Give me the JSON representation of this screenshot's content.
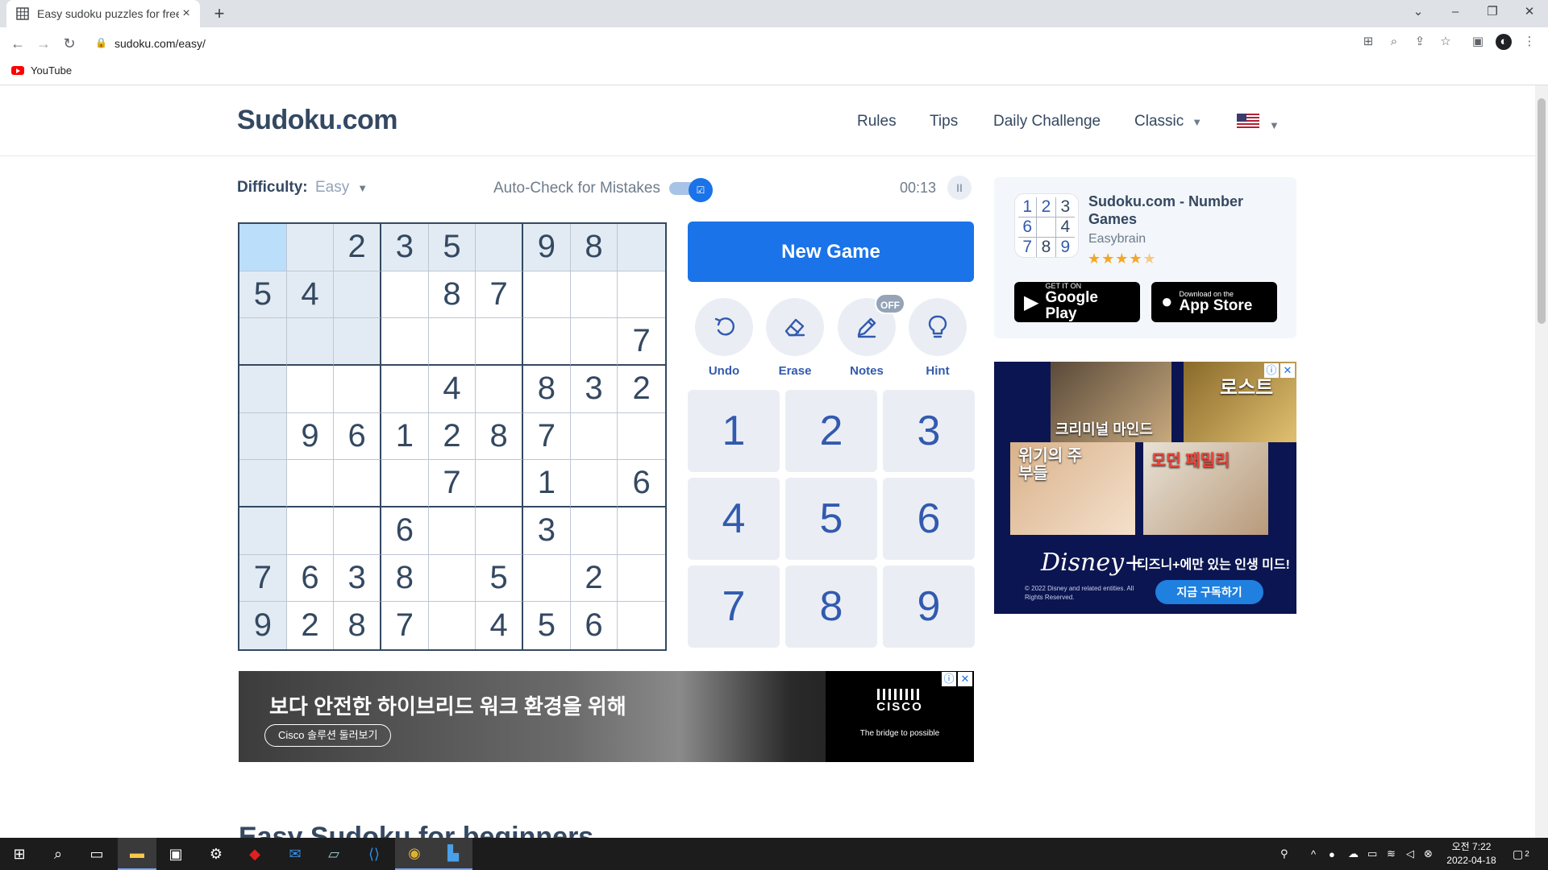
{
  "browser": {
    "tab_title": "Easy sudoku puzzles for free",
    "tab_close": "×",
    "new_tab": "+",
    "url": "sudoku.com/easy/",
    "bookmark": "YouTube"
  },
  "site": {
    "logo_main": "Sudoku",
    "logo_dot": ".",
    "logo_tld": "com",
    "nav": {
      "rules": "Rules",
      "tips": "Tips",
      "daily": "Daily Challenge",
      "classic": "Classic"
    }
  },
  "game": {
    "difficulty_label": "Difficulty:",
    "difficulty_value": "Easy",
    "autocheck_label": "Auto-Check for Mistakes",
    "autocheck_on": true,
    "timer": "00:13",
    "new_game": "New Game",
    "tools": {
      "undo": "Undo",
      "erase": "Erase",
      "notes": "Notes",
      "hint": "Hint",
      "notes_badge": "OFF"
    },
    "numpad": [
      "1",
      "2",
      "3",
      "4",
      "5",
      "6",
      "7",
      "8",
      "9"
    ],
    "selected": {
      "row": 0,
      "col": 0
    },
    "grid": [
      [
        "",
        "",
        "2",
        "3",
        "5",
        "",
        "9",
        "8",
        ""
      ],
      [
        "5",
        "4",
        "",
        "",
        "8",
        "7",
        "",
        "",
        ""
      ],
      [
        "",
        "",
        "",
        "",
        "",
        "",
        "",
        "",
        "7"
      ],
      [
        "",
        "",
        "",
        "",
        "4",
        "",
        "8",
        "3",
        "2"
      ],
      [
        "",
        "9",
        "6",
        "1",
        "2",
        "8",
        "7",
        "",
        ""
      ],
      [
        "",
        "",
        "",
        "",
        "7",
        "",
        "1",
        "",
        "6"
      ],
      [
        "",
        "",
        "",
        "6",
        "",
        "",
        "3",
        "",
        ""
      ],
      [
        "7",
        "6",
        "3",
        "8",
        "",
        "5",
        "",
        "2",
        ""
      ],
      [
        "9",
        "2",
        "8",
        "7",
        "",
        "4",
        "5",
        "6",
        ""
      ]
    ]
  },
  "app": {
    "name": "Sudoku.com - Number Games",
    "developer": "Easybrain",
    "rating": "★★★★",
    "rating_half": "★",
    "icon_digits": [
      "1",
      "2",
      "3",
      "6",
      "",
      "4",
      "7",
      "8",
      "9"
    ],
    "google_small": "GET IT ON",
    "google_big": "Google Play",
    "apple_small": "Download on the",
    "apple_big": "App Store"
  },
  "ad_right": {
    "poster1": "크리미널 마인드",
    "poster2": "로스트",
    "poster3": "위기의 주부들",
    "poster4": "모던 패밀리",
    "brand": "Disney+",
    "copyright": "© 2022 Disney and related entities. All Rights Reserved.",
    "tagline": "디즈니+에만 있는 인생 미드!",
    "cta": "지금 구독하기"
  },
  "ad_bottom": {
    "headline": "보다 안전한 하이브리드 워크 환경을 위해",
    "cta": "Cisco 솔루션 둘러보기",
    "brand": "CISCO",
    "tagline": "The bridge to possible"
  },
  "section_title": "Easy Sudoku for beginners",
  "taskbar": {
    "time": "오전 7:22",
    "date": "2022-04-18",
    "notif_count": "2"
  }
}
